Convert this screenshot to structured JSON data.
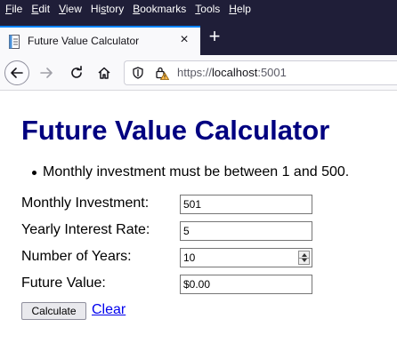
{
  "menu": [
    {
      "label": "File",
      "acc": "F",
      "rest": "ile"
    },
    {
      "label": "Edit",
      "acc": "E",
      "rest": "dit"
    },
    {
      "label": "View",
      "acc": "V",
      "rest": "iew"
    },
    {
      "label": "History",
      "acc": "s",
      "pre": "Hi",
      "rest": "tory"
    },
    {
      "label": "Bookmarks",
      "acc": "B",
      "rest": "ookmarks"
    },
    {
      "label": "Tools",
      "acc": "T",
      "rest": "ools"
    },
    {
      "label": "Help",
      "acc": "H",
      "rest": "elp"
    }
  ],
  "tab": {
    "title": "Future Value Calculator",
    "close": "×"
  },
  "newtab": "+",
  "url": {
    "scheme": "https://",
    "host": "localhost",
    "port": ":5001"
  },
  "page": {
    "title": "Future Value Calculator",
    "errors": [
      "Monthly investment must be between 1 and 500."
    ],
    "fields": {
      "investment": {
        "label": "Monthly Investment:",
        "value": "501"
      },
      "rate": {
        "label": "Yearly Interest Rate:",
        "value": "5"
      },
      "years": {
        "label": "Number of Years:",
        "value": "10"
      },
      "future": {
        "label": "Future Value:",
        "value": "$0.00"
      }
    },
    "calculate_label": "Calculate",
    "clear_label": "Clear"
  },
  "colors": {
    "menubar": "#1f1e38",
    "title": "#000080",
    "link": "#0000ee",
    "tab_accent": "#0a84ff"
  }
}
